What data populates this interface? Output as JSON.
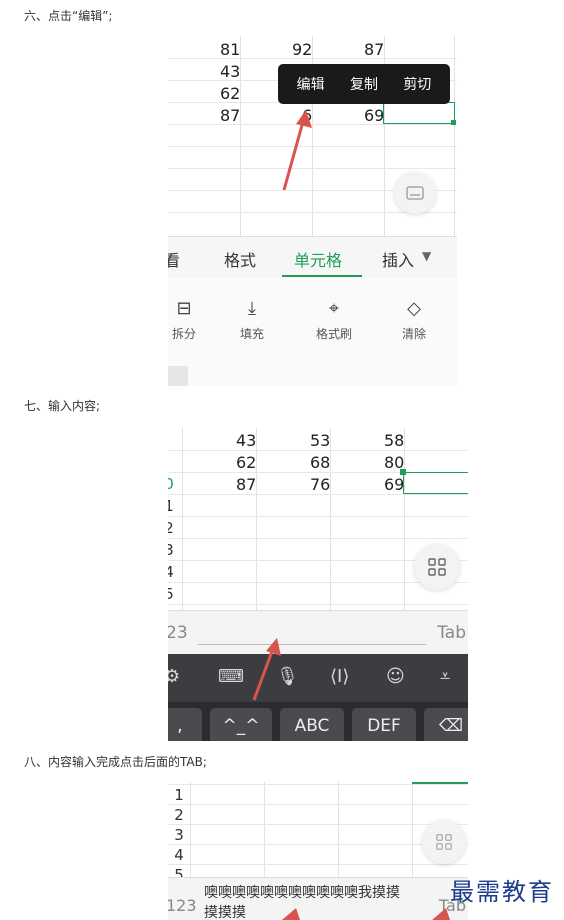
{
  "captions": {
    "step6": "六、点击“编辑”;",
    "step7": "七、输入内容;",
    "step8": "八、内容输入完成点击后面的TAB;"
  },
  "shot1": {
    "rows": [
      [
        "81",
        "92",
        "87"
      ],
      [
        "43",
        "",
        ""
      ],
      [
        "62",
        "",
        ""
      ],
      [
        "87",
        "6",
        "69"
      ]
    ],
    "context_menu": [
      "编辑",
      "复制",
      "剪切"
    ],
    "tabs": [
      "看",
      "格式",
      "单元格",
      "插入"
    ],
    "active_tab": "单元格",
    "tools": [
      "拆分",
      "填充",
      "格式刷",
      "清除"
    ]
  },
  "shot2": {
    "rows": [
      [
        "43",
        "53",
        "58"
      ],
      [
        "62",
        "68",
        "80"
      ],
      [
        "87",
        "76",
        "69"
      ]
    ],
    "row_numbers": [
      "0",
      "1",
      "2",
      "3",
      "4",
      "5",
      "5"
    ],
    "input_left": "23",
    "tab_label": "Tab",
    "keys": [
      ",",
      "^_^",
      "ABC",
      "DEF",
      "⌫"
    ]
  },
  "shot3": {
    "row_numbers": [
      "1",
      "2",
      "3",
      "4",
      "5"
    ],
    "candidate_line1": "噢噢噢噢噢噢噢噢噢噢噢我摸摸",
    "candidate_line2": "摸摸摸",
    "input_left": "123",
    "tab_label": "Tab"
  },
  "watermark": "最需教育",
  "colors": {
    "accent_green": "#1e9e58",
    "arrow_red": "#d9534f",
    "keyboard_dark": "#2b2c2f",
    "watermark_blue": "#1d3b8f"
  }
}
